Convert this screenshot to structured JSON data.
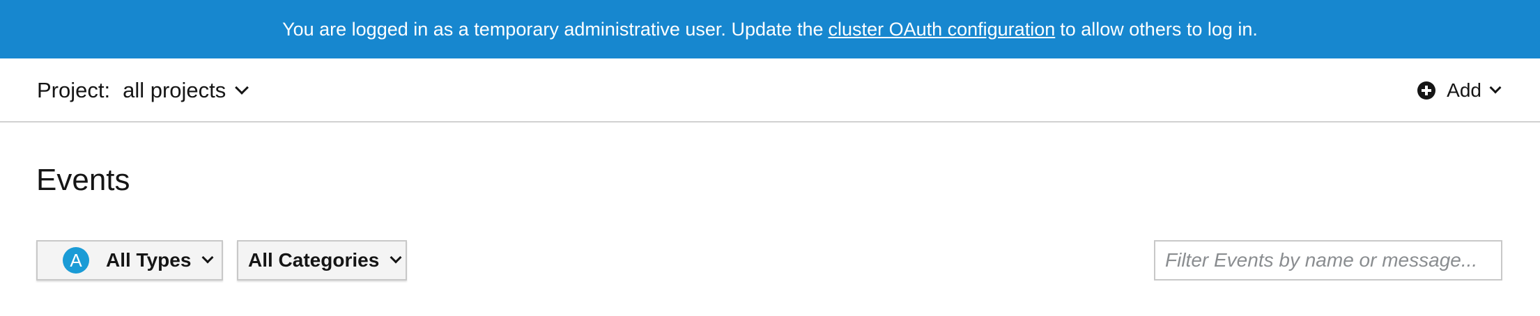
{
  "banner": {
    "text_before": "You are logged in as a temporary administrative user. Update the",
    "link_text": "cluster OAuth configuration",
    "text_after": "to allow others to log in."
  },
  "project_bar": {
    "label": "Project:",
    "value": "all projects",
    "add_label": "Add"
  },
  "page": {
    "title": "Events"
  },
  "filters": {
    "types_badge": "A",
    "types_label": "All Types",
    "categories_label": "All Categories",
    "search_placeholder": "Filter Events by name or message..."
  },
  "colors": {
    "banner_bg": "#1787cf",
    "badge_bg": "#1a9bd6"
  },
  "icons": {
    "add": "plus-circle-icon",
    "dropdown": "chevron-down-icon"
  }
}
